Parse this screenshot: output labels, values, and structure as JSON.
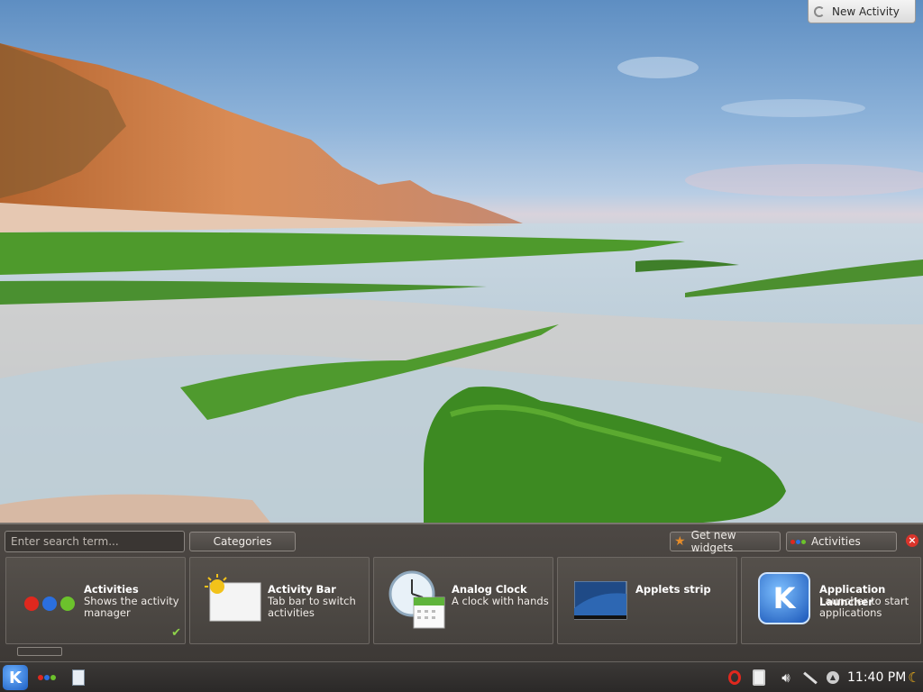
{
  "desktop": {
    "new_activity_label": "New Activity"
  },
  "explorer": {
    "search_placeholder": "Enter search term...",
    "categories_label": "Categories",
    "get_new_widgets_label": "Get new widgets",
    "activities_label": "Activities",
    "widgets": [
      {
        "title": "Activities",
        "desc_line1": "Shows the activity",
        "desc_line2": "manager",
        "icon": "activities-dots-icon",
        "installed": true
      },
      {
        "title": "Activity Bar",
        "desc_line1": "Tab bar to switch",
        "desc_line2": "activities",
        "icon": "activity-bar-icon",
        "installed": false
      },
      {
        "title": "Analog Clock",
        "desc_line1": "A clock with hands",
        "desc_line2": "",
        "icon": "analog-clock-icon",
        "installed": false
      },
      {
        "title": "Applets strip",
        "desc_line1": "",
        "desc_line2": "",
        "icon": "applets-strip-icon",
        "installed": false
      },
      {
        "title": "Application Launcher",
        "desc_line1": "Launcher to start",
        "desc_line2": "applications",
        "icon": "kde-launcher-icon",
        "installed": false
      }
    ]
  },
  "taskbar": {
    "clock": "11:40 PM",
    "tray_icons": [
      "opera-icon",
      "clipboard-icon",
      "volume-icon",
      "network-icon",
      "show-hidden-icon",
      "moon-icon"
    ]
  },
  "colors": {
    "dot_red": "#e0281e",
    "dot_blue": "#2b6fe0",
    "dot_green": "#6cc22c",
    "close_red": "#d9342b",
    "check_green": "#8fd34a"
  }
}
